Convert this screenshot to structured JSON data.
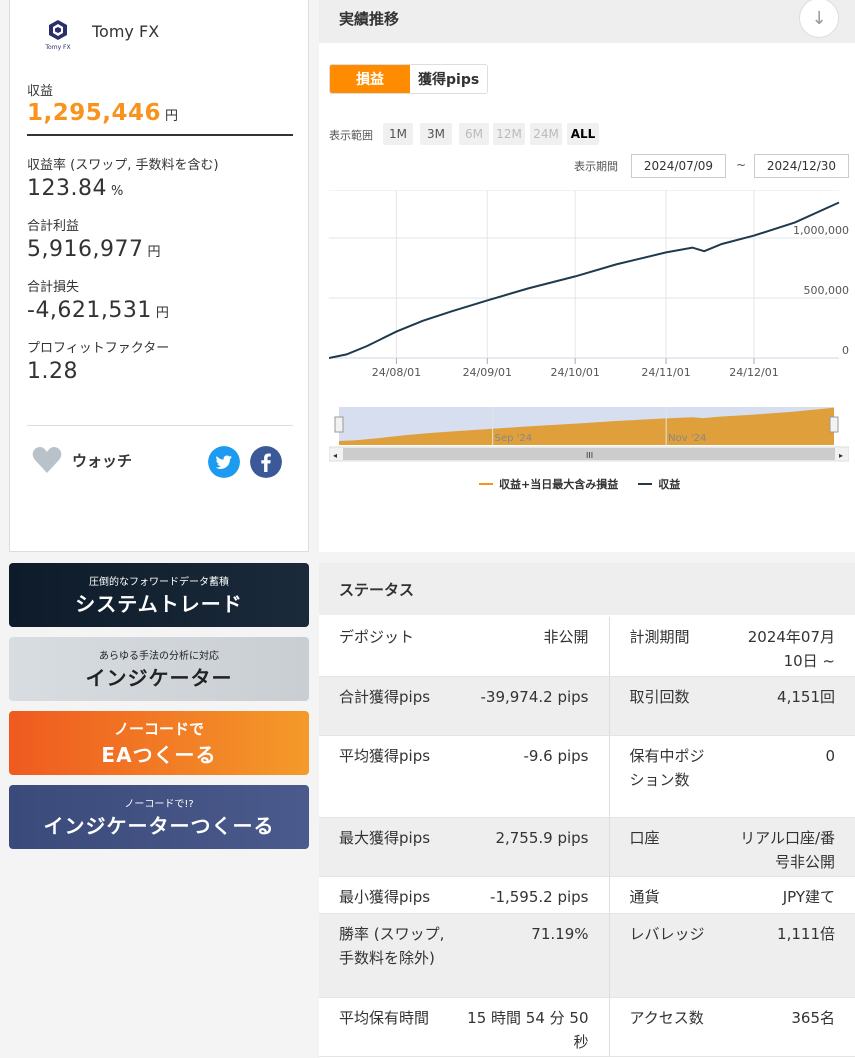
{
  "profile": {
    "name": "Tomy FX",
    "logo_text": "Tomy FX",
    "profit_label": "収益",
    "profit_value": "1,295,446",
    "yen": "円",
    "rate_label": "収益率 (スワップ, 手数料を含む)",
    "rate_value": "123.84",
    "percent": "%",
    "gross_profit_label": "合計利益",
    "gross_profit_value": "5,916,977",
    "gross_loss_label": "合計損失",
    "gross_loss_value": "-4,621,531",
    "pf_label": "プロフィットファクター",
    "pf_value": "1.28",
    "watch_label": "ウォッチ",
    "social": [
      "twitter-icon",
      "facebook-icon"
    ]
  },
  "performance": {
    "title": "実績推移",
    "toggle": [
      "損益",
      "獲得pips"
    ],
    "range_label": "表示範囲",
    "ranges": [
      "1M",
      "3M",
      "6M",
      "12M",
      "24M",
      "ALL"
    ],
    "period_label": "表示期間",
    "start_date": "2024/07/09",
    "tilde": "~",
    "end_date": "2024/12/30",
    "navigator_labels": [
      "Sep '24",
      "Nov '24"
    ],
    "legend": [
      "収益+当日最大含み損益",
      "収益"
    ]
  },
  "chart_data": {
    "type": "line",
    "x_ticks": [
      "24/08/01",
      "24/09/01",
      "24/10/01",
      "24/11/01",
      "24/12/01"
    ],
    "y_ticks": [
      "0",
      "500,000",
      "1,000,000"
    ],
    "ylim": [
      0,
      1400000
    ],
    "series": [
      {
        "name": "収益",
        "color": "#1f3a4d",
        "x": [
          "2024-07-09",
          "2024-07-15",
          "2024-07-22",
          "2024-08-01",
          "2024-08-10",
          "2024-08-20",
          "2024-09-01",
          "2024-09-15",
          "2024-10-01",
          "2024-10-15",
          "2024-11-01",
          "2024-11-10",
          "2024-11-14",
          "2024-11-20",
          "2024-12-01",
          "2024-12-15",
          "2024-12-30"
        ],
        "values": [
          0,
          30000,
          100000,
          220000,
          310000,
          390000,
          480000,
          580000,
          680000,
          780000,
          880000,
          920000,
          890000,
          950000,
          1020000,
          1130000,
          1295446
        ]
      },
      {
        "name": "収益+当日最大含み損益",
        "color": "#f7931e",
        "x": [
          "2024-07-09",
          "2024-12-30"
        ],
        "values": [
          0,
          1295446
        ]
      }
    ],
    "grid": true
  },
  "banners": [
    {
      "small": "圧倒的なフォワードデータ蓄積",
      "big": "システムトレード"
    },
    {
      "small": "あらゆる手法の分析に対応",
      "big": "インジケーター"
    },
    {
      "small": "ノーコードで",
      "big": "EAつくーる"
    },
    {
      "small": "ノーコードで!?",
      "big": "インジケーターつくーる"
    }
  ],
  "status": {
    "title": "ステータス",
    "rows": [
      {
        "k1": "デポジット",
        "v1": "非公開",
        "k2": "計測期間",
        "v2": "2024年07月10日 ~"
      },
      {
        "k1": "合計獲得pips",
        "v1": "-39,974.2 pips",
        "k2": "取引回数",
        "v2": "4,151回"
      },
      {
        "k1": "平均獲得pips",
        "v1": "-9.6 pips",
        "k2": "保有中ポジション数",
        "v2": "0"
      },
      {
        "k1": "最大獲得pips",
        "v1": "2,755.9 pips",
        "k2": "口座",
        "v2": "リアル口座/番号非公開"
      },
      {
        "k1": "最小獲得pips",
        "v1": "-1,595.2 pips",
        "k2": "通貨",
        "v2": "JPY建て"
      },
      {
        "k1": "勝率 (スワップ, 手数料を除外)",
        "v1": "71.19%",
        "k2": "レバレッジ",
        "v2": "1,111倍"
      },
      {
        "k1": "平均保有時間",
        "v1": "15 時間 54 分 50 秒",
        "k2": "アクセス数",
        "v2": "365名"
      }
    ]
  }
}
